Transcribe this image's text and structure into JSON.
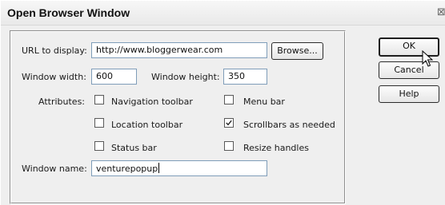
{
  "window": {
    "title": "Open Browser Window",
    "close_glyph": "⊠"
  },
  "form": {
    "url_label": "URL to display:",
    "url_value": "http://www.bloggerwear.com",
    "browse_label": "Browse...",
    "width_label": "Window width:",
    "width_value": "600",
    "height_label": "Window height:",
    "height_value": "350",
    "attributes_label": "Attributes:",
    "attributes": [
      {
        "label": "Navigation toolbar",
        "checked": false
      },
      {
        "label": "Menu bar",
        "checked": false
      },
      {
        "label": "Location toolbar",
        "checked": false
      },
      {
        "label": "Scrollbars as needed",
        "checked": true
      },
      {
        "label": "Status bar",
        "checked": false
      },
      {
        "label": "Resize handles",
        "checked": false
      }
    ],
    "name_label": "Window name:",
    "name_value": "venturepopup"
  },
  "buttons": {
    "ok_label": "OK",
    "cancel_label": "Cancel",
    "help_label": "Help"
  }
}
